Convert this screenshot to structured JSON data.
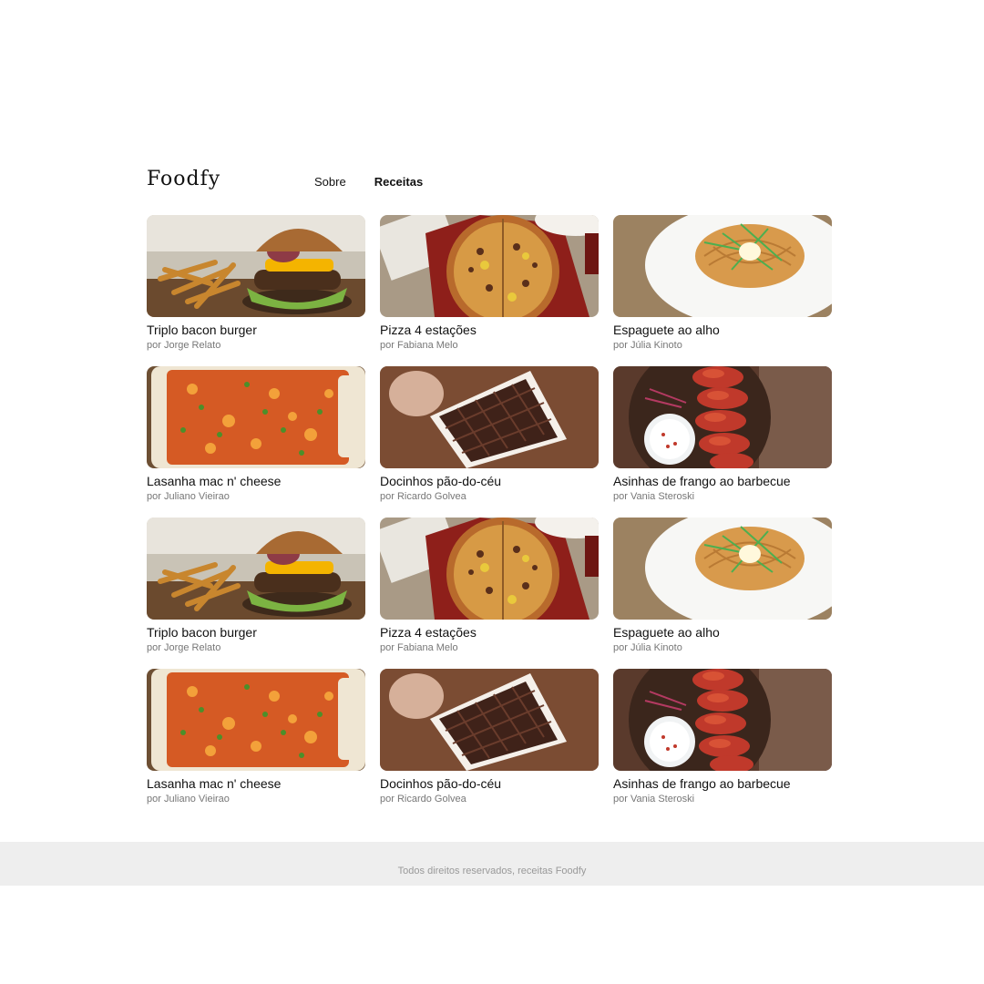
{
  "header": {
    "logo": "Foodfy",
    "nav": [
      {
        "label": "Sobre",
        "active": false
      },
      {
        "label": "Receitas",
        "active": true
      }
    ]
  },
  "recipes": [
    {
      "title": "Triplo bacon burger",
      "author": "por Jorge Relato",
      "image": "burger"
    },
    {
      "title": "Pizza 4 estações",
      "author": "por Fabiana Melo",
      "image": "pizza"
    },
    {
      "title": "Espaguete ao alho",
      "author": "por Júlia Kinoto",
      "image": "spaghetti"
    },
    {
      "title": "Lasanha mac n' cheese",
      "author": "por Juliano Vieirao",
      "image": "lasagna"
    },
    {
      "title": "Docinhos pão-do-céu",
      "author": "por Ricardo Golvea",
      "image": "chocolates"
    },
    {
      "title": "Asinhas de frango ao barbecue",
      "author": "por Vania Steroski",
      "image": "wings"
    },
    {
      "title": "Triplo bacon burger",
      "author": "por Jorge Relato",
      "image": "burger"
    },
    {
      "title": "Pizza 4 estações",
      "author": "por Fabiana Melo",
      "image": "pizza"
    },
    {
      "title": "Espaguete ao alho",
      "author": "por Júlia Kinoto",
      "image": "spaghetti"
    },
    {
      "title": "Lasanha mac n' cheese",
      "author": "por Juliano Vieirao",
      "image": "lasagna"
    },
    {
      "title": "Docinhos pão-do-céu",
      "author": "por Ricardo Golvea",
      "image": "chocolates"
    },
    {
      "title": "Asinhas de frango ao barbecue",
      "author": "por Vania Steroski",
      "image": "wings"
    }
  ],
  "footer": {
    "text": "Todos direitos reservados, receitas Foodfy"
  }
}
